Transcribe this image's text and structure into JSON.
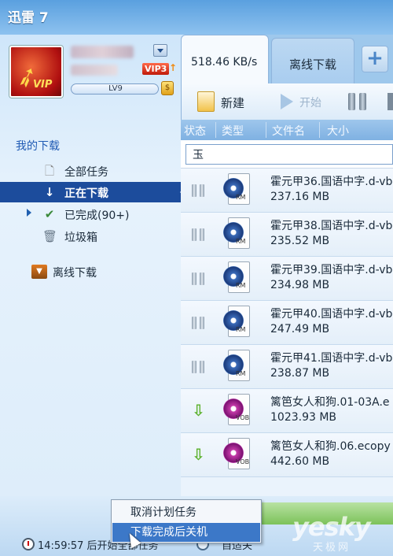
{
  "app": {
    "title": "迅雷 7"
  },
  "account": {
    "vip_badge": "VIP3",
    "level": "LV9",
    "avatar_label": "VIP"
  },
  "sidebar": {
    "section_title": "我的下载",
    "items": [
      {
        "label": "全部任务",
        "icon": "document-icon"
      },
      {
        "label": "正在下载",
        "icon": "download-arrow-icon",
        "selected": true
      },
      {
        "label": "已完成(90+)",
        "icon": "checkmark-icon"
      },
      {
        "label": "垃圾箱",
        "icon": "trash-icon"
      }
    ],
    "offline_label": "离线下载"
  },
  "tabs": {
    "speed": "518.46 KB/s",
    "offline": "离线下载",
    "add": "+"
  },
  "toolbar": {
    "new_label": "新建",
    "start_label": "开始"
  },
  "columns": [
    "状态",
    "类型",
    "文件名",
    "大小"
  ],
  "search": {
    "value": "玉"
  },
  "downloads": [
    {
      "status": "paused",
      "type": "RM",
      "name": "霍元甲36.国语中字.d-vb",
      "size": "237.16 MB"
    },
    {
      "status": "paused",
      "type": "RM",
      "name": "霍元甲38.国语中字.d-vb",
      "size": "235.52 MB"
    },
    {
      "status": "paused",
      "type": "RM",
      "name": "霍元甲39.国语中字.d-vb",
      "size": "234.98 MB"
    },
    {
      "status": "paused",
      "type": "RM",
      "name": "霍元甲40.国语中字.d-vb",
      "size": "247.49 MB"
    },
    {
      "status": "paused",
      "type": "RM",
      "name": "霍元甲41.国语中字.d-vb",
      "size": "238.87 MB"
    },
    {
      "status": "downloading",
      "type": "VOB",
      "name": "篱笆女人和狗.01-03A.e",
      "size": "1023.93 MB"
    },
    {
      "status": "downloading",
      "type": "VOB",
      "name": "篱笆女人和狗.06.ecopy",
      "size": "442.60 MB"
    }
  ],
  "context_menu": {
    "items": [
      "取消计划任务",
      "下载完成后关机"
    ],
    "highlighted_index": 1
  },
  "statusbar": {
    "schedule_text": "14:59:57 后开始全部任务",
    "auto_text": "自适关"
  },
  "watermark": {
    "main": "yesky",
    "sub": "天极网"
  },
  "colors": {
    "selected_nav": "#1c4c9c",
    "menu_highlight": "#3c78c8",
    "header": "#7fb1e2"
  }
}
